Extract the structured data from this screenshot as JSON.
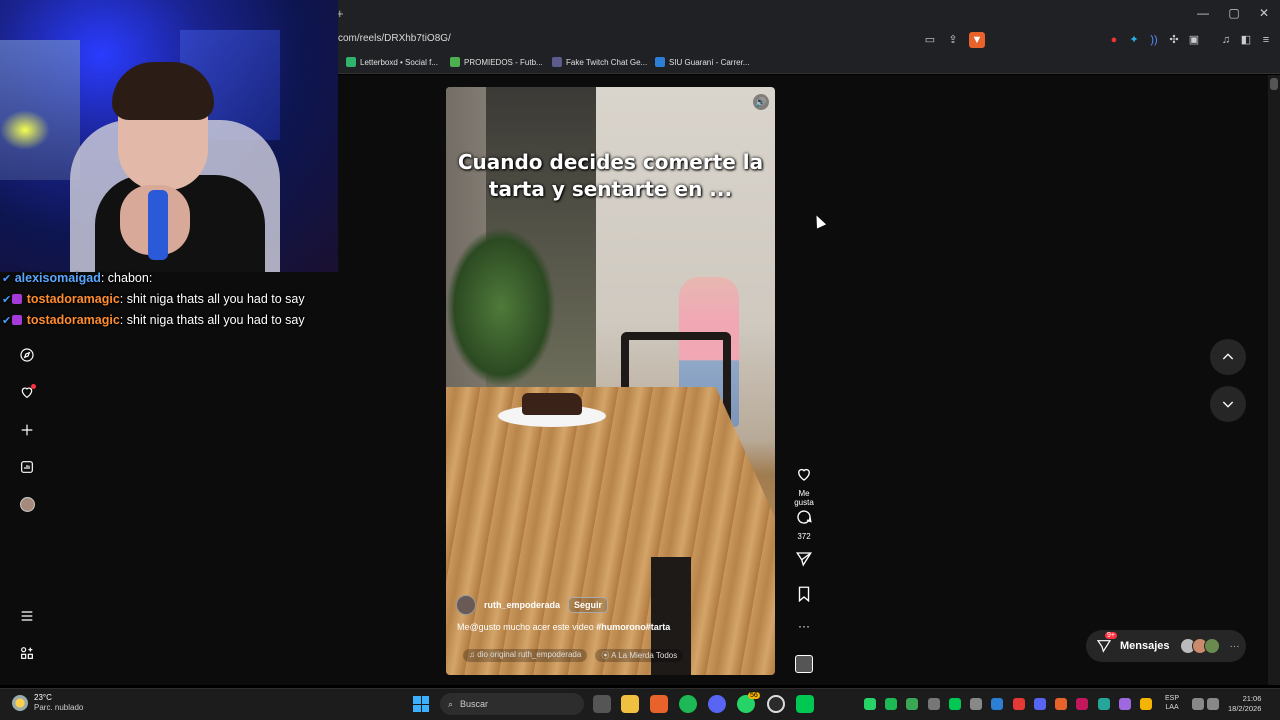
{
  "browser": {
    "new_tab": "+",
    "url": "com/reels/DRXhb7tiO8G/",
    "window_controls": {
      "minimize": "—",
      "maximize": "▢",
      "close": "✕"
    },
    "bookmarks": [
      {
        "label": "Letterboxd • Social f...",
        "color": "#2fb36d"
      },
      {
        "label": "PROMIEDOS - Futb...",
        "color": "#4caf50"
      },
      {
        "label": "Fake Twitch Chat Ge...",
        "color": "#5b5b8c"
      },
      {
        "label": "SIU Guaraní - Carrer...",
        "color": "#2d7fd6"
      }
    ]
  },
  "chat": [
    {
      "user": "alexisomaigad",
      "message": ": chabon:",
      "user_color": "#5aa7ff"
    },
    {
      "user": "tostadoramagic",
      "message": ": shit niga thats all you had to say",
      "user_color": "#ff8c2e"
    },
    {
      "user": "tostadoramagic",
      "message": ": shit niga thats all you had to say",
      "user_color": "#ff8c2e"
    }
  ],
  "reel": {
    "caption_line1": "Cuando decides comerte la",
    "caption_line2": "tarta y sentarte en ...",
    "author": "ruth_empoderada",
    "follow": "Seguir",
    "description_prefix": "Me@gusto mucho acer este video ",
    "description_tags": "#humorono#tarta",
    "audio_label": "dio original  ruth_empoderada",
    "location": "A La Mierda Todos"
  },
  "actions": {
    "like_label": "Me gusta",
    "comments_count": "372",
    "more": "···"
  },
  "messages": {
    "label": "Mensajes",
    "badge": "9+",
    "more": "···"
  },
  "taskbar": {
    "temperature": "23°C",
    "weather": "Parc. nublado",
    "search_placeholder": "Buscar",
    "lang_line1": "ESP",
    "lang_line2": "LAA",
    "time": "21:06",
    "date": "18/2/2026",
    "whatsapp_badge": "56"
  }
}
